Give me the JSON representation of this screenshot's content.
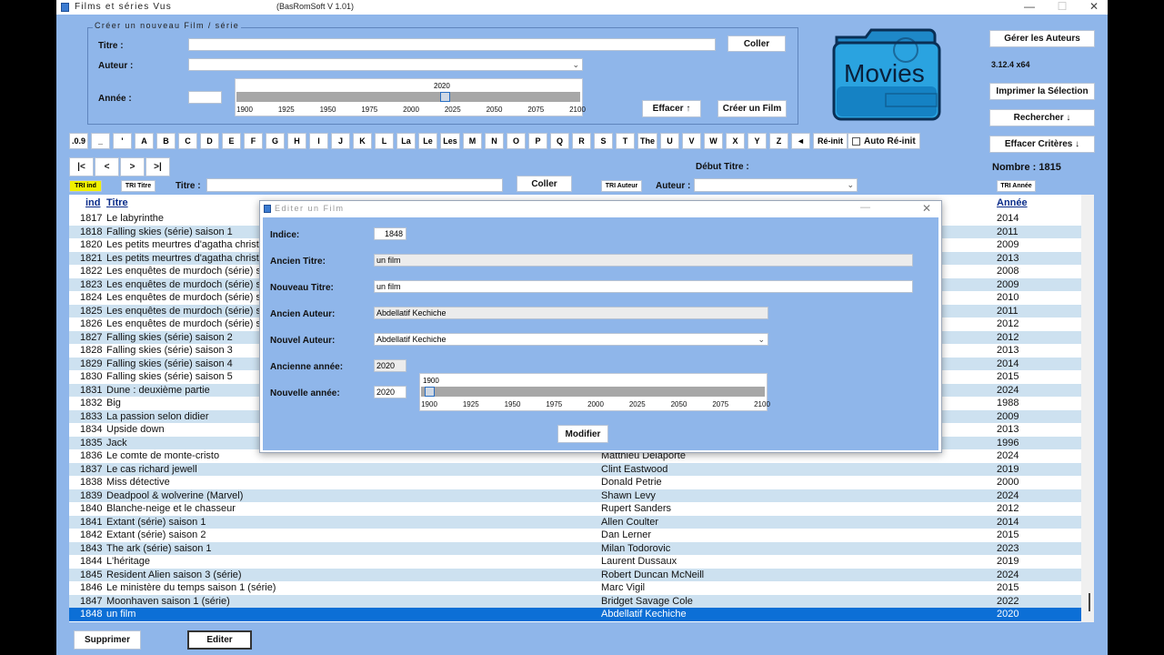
{
  "window": {
    "title": "Films et séries   Vus",
    "subtitle": "(BasRomSoft V 1.01)",
    "min": "—",
    "max": "☐",
    "close": "✕"
  },
  "create_group": {
    "title": "Créer un nouveau Film / série",
    "titre_label": "Titre :",
    "auteur_label": "Auteur :",
    "annee_label": "Année :",
    "titre_value": "",
    "auteur_value": "",
    "annee_value": "",
    "coller": "Coller",
    "effacer": "Effacer ↑",
    "creer": "Créer un Film",
    "slider_value_label": "2020",
    "slider_value": 2020,
    "slider_ticks": [
      "1900",
      "1925",
      "1950",
      "1975",
      "2000",
      "2025",
      "2050",
      "2075",
      "2100"
    ]
  },
  "logo_text": "Movies",
  "right_panel": {
    "gerer_auteurs": "Gérer les Auteurs",
    "version": "3.12.4 x64",
    "imprimer": "Imprimer la Sélection",
    "rechercher": "Rechercher ↓",
    "effacer_criteres": "Effacer Critères ↓",
    "nombre": "Nombre : 1815"
  },
  "letters": [
    ".0.9",
    "_",
    "'",
    "A",
    "B",
    "C",
    "D",
    "E",
    "F",
    "G",
    "H",
    "I",
    "J",
    "K",
    "L",
    "La",
    "Le",
    "Les",
    "M",
    "N",
    "O",
    "P",
    "Q",
    "R",
    "S",
    "T",
    "The",
    "U",
    "V",
    "W",
    "X",
    "Y",
    "Z",
    "◄",
    "Ré-init"
  ],
  "auto_reinit": "Auto Ré-init",
  "nav": [
    "|<",
    "<",
    ">",
    ">|"
  ],
  "filter": {
    "debut_titre": "Début Titre :",
    "tri_ind": "TRI ind",
    "tri_titre": "TRI Titre",
    "titre_label": "Titre :",
    "titre_value": "",
    "coller": "Coller",
    "tri_auteur": "TRI Auteur",
    "auteur_label": "Auteur :",
    "auteur_value": "",
    "tri_annee": "TRI Année"
  },
  "grid": {
    "headers": {
      "ind": "ind",
      "titre": "Titre",
      "auteur": "",
      "annee": "Année"
    },
    "rows": [
      {
        "ind": "1817",
        "titre": "Le labyrinthe",
        "auteur": "",
        "annee": "2014"
      },
      {
        "ind": "1818",
        "titre": "Falling skies (série) saison 1",
        "auteur": "",
        "annee": "2011"
      },
      {
        "ind": "1820",
        "titre": "Les petits meurtres d'agatha christie",
        "auteur": "",
        "annee": "2009"
      },
      {
        "ind": "1821",
        "titre": "Les petits meurtres d'agatha christie",
        "auteur": "",
        "annee": "2013"
      },
      {
        "ind": "1822",
        "titre": "Les enquêtes de murdoch (série) sa",
        "auteur": "",
        "annee": "2008"
      },
      {
        "ind": "1823",
        "titre": "Les enquêtes de murdoch (série) sa",
        "auteur": "",
        "annee": "2009"
      },
      {
        "ind": "1824",
        "titre": "Les enquêtes de murdoch (série) sa",
        "auteur": "",
        "annee": "2010"
      },
      {
        "ind": "1825",
        "titre": "Les enquêtes de murdoch (série) sa",
        "auteur": "",
        "annee": "2011"
      },
      {
        "ind": "1826",
        "titre": "Les enquêtes de murdoch (série) sa",
        "auteur": "",
        "annee": "2012"
      },
      {
        "ind": "1827",
        "titre": "Falling skies (série) saison 2",
        "auteur": "",
        "annee": "2012"
      },
      {
        "ind": "1828",
        "titre": "Falling skies (série) saison 3",
        "auteur": "",
        "annee": "2013"
      },
      {
        "ind": "1829",
        "titre": "Falling skies (série) saison 4",
        "auteur": "",
        "annee": "2014"
      },
      {
        "ind": "1830",
        "titre": "Falling skies (série) saison 5",
        "auteur": "",
        "annee": "2015"
      },
      {
        "ind": "1831",
        "titre": "Dune : deuxième partie",
        "auteur": "",
        "annee": "2024"
      },
      {
        "ind": "1832",
        "titre": "Big",
        "auteur": "",
        "annee": "1988"
      },
      {
        "ind": "1833",
        "titre": "La passion selon didier",
        "auteur": "",
        "annee": "2009"
      },
      {
        "ind": "1834",
        "titre": "Upside down",
        "auteur": "",
        "annee": "2013"
      },
      {
        "ind": "1835",
        "titre": "Jack",
        "auteur": "",
        "annee": "1996"
      },
      {
        "ind": "1836",
        "titre": "Le comte de monte-cristo",
        "auteur": "Matthieu Delaporte",
        "annee": "2024"
      },
      {
        "ind": "1837",
        "titre": "Le cas richard jewell",
        "auteur": "Clint Eastwood",
        "annee": "2019"
      },
      {
        "ind": "1838",
        "titre": "Miss détective",
        "auteur": "Donald Petrie",
        "annee": "2000"
      },
      {
        "ind": "1839",
        "titre": "Deadpool & wolverine   (Marvel)",
        "auteur": "Shawn Levy",
        "annee": "2024"
      },
      {
        "ind": "1840",
        "titre": "Blanche-neige et le chasseur",
        "auteur": "Rupert Sanders",
        "annee": "2012"
      },
      {
        "ind": "1841",
        "titre": "Extant (série) saison 1",
        "auteur": "Allen Coulter",
        "annee": "2014"
      },
      {
        "ind": "1842",
        "titre": "Extant (série) saison 2",
        "auteur": "Dan Lerner",
        "annee": "2015"
      },
      {
        "ind": "1843",
        "titre": "The ark (série) saison 1",
        "auteur": "Milan Todorovic",
        "annee": "2023"
      },
      {
        "ind": "1844",
        "titre": "L'héritage",
        "auteur": "Laurent Dussaux",
        "annee": "2019"
      },
      {
        "ind": "1845",
        "titre": "Resident Alien  saison 3  (série)",
        "auteur": "Robert Duncan McNeill",
        "annee": "2024"
      },
      {
        "ind": "1846",
        "titre": "Le ministère du temps saison 1 (série)",
        "auteur": "Marc Vigil",
        "annee": "2015"
      },
      {
        "ind": "1847",
        "titre": "Moonhaven saison 1 (série)",
        "auteur": "Bridget Savage Cole",
        "annee": "2022"
      },
      {
        "ind": "1848",
        "titre": "un film",
        "auteur": "Abdellatif Kechiche",
        "annee": "2020"
      }
    ]
  },
  "bottom": {
    "supprimer": "Supprimer",
    "editer": "Editer"
  },
  "dialog": {
    "title": "Editer un Film",
    "indice_label": "Indice:",
    "indice": "1848",
    "ancien_titre_label": "Ancien Titre:",
    "ancien_titre": "un film",
    "nouveau_titre_label": "Nouveau Titre:",
    "nouveau_titre": "un film",
    "ancien_auteur_label": "Ancien Auteur:",
    "ancien_auteur": "Abdellatif Kechiche",
    "nouvel_auteur_label": "Nouvel Auteur:",
    "nouvel_auteur": "Abdellatif Kechiche",
    "ancienne_annee_label": "Ancienne année:",
    "ancienne_annee": "2020",
    "nouvelle_annee_label": "Nouvelle année:",
    "nouvelle_annee": "2020",
    "slider_value_label": "1900",
    "slider_value": 1900,
    "slider_ticks": [
      "1900",
      "1925",
      "1950",
      "1975",
      "2000",
      "2025",
      "2050",
      "2075",
      "2100"
    ],
    "modifier": "Modifier"
  }
}
